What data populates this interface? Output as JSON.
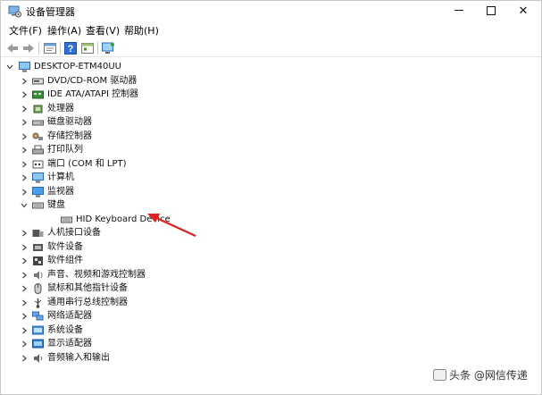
{
  "window": {
    "title": "设备管理器",
    "controls": {
      "minimize": "",
      "maximize": "",
      "close": "✕"
    }
  },
  "menubar": {
    "items": [
      "文件(F)",
      "操作(A)",
      "查看(V)",
      "帮助(H)"
    ]
  },
  "toolbar": {
    "icons": [
      "back-arrow-icon",
      "forward-arrow-icon",
      "properties-icon",
      "help-icon",
      "view-icon",
      "monitor-scan-icon"
    ]
  },
  "tree": {
    "root": {
      "label": "DESKTOP-ETM40UU",
      "expanded": true
    },
    "items": [
      {
        "label": "DVD/CD-ROM 驱动器",
        "icon": "dvd-drive-icon",
        "expanded": false
      },
      {
        "label": "IDE ATA/ATAPI 控制器",
        "icon": "ide-controller-icon",
        "expanded": false
      },
      {
        "label": "处理器",
        "icon": "processor-icon",
        "expanded": false
      },
      {
        "label": "磁盘驱动器",
        "icon": "disk-drive-icon",
        "expanded": false
      },
      {
        "label": "存储控制器",
        "icon": "storage-controller-icon",
        "expanded": false
      },
      {
        "label": "打印队列",
        "icon": "printer-icon",
        "expanded": false
      },
      {
        "label": "端口 (COM 和 LPT)",
        "icon": "port-icon",
        "expanded": false
      },
      {
        "label": "计算机",
        "icon": "computer-icon",
        "expanded": false
      },
      {
        "label": "监视器",
        "icon": "monitor-icon",
        "expanded": false
      },
      {
        "label": "键盘",
        "icon": "keyboard-icon",
        "expanded": true
      },
      {
        "label": "HID Keyboard Device",
        "icon": "keyboard-icon",
        "child": true
      },
      {
        "label": "人机接口设备",
        "icon": "hid-icon",
        "expanded": false
      },
      {
        "label": "软件设备",
        "icon": "software-device-icon",
        "expanded": false
      },
      {
        "label": "软件组件",
        "icon": "software-component-icon",
        "expanded": false
      },
      {
        "label": "声音、视频和游戏控制器",
        "icon": "sound-icon",
        "expanded": false
      },
      {
        "label": "鼠标和其他指针设备",
        "icon": "mouse-icon",
        "expanded": false
      },
      {
        "label": "通用串行总线控制器",
        "icon": "usb-icon",
        "expanded": false
      },
      {
        "label": "网络适配器",
        "icon": "network-adapter-icon",
        "expanded": false
      },
      {
        "label": "系统设备",
        "icon": "system-device-icon",
        "expanded": false
      },
      {
        "label": "显示适配器",
        "icon": "display-adapter-icon",
        "expanded": false
      },
      {
        "label": "音频输入和输出",
        "icon": "audio-io-icon",
        "expanded": false
      }
    ]
  },
  "annotation": {
    "color": "#e02020"
  },
  "watermark": {
    "text": "头条 @网信传递"
  },
  "colors": {
    "accent": "#1e6fd0",
    "arrow": "#e02020",
    "border": "#c9c9c9"
  }
}
